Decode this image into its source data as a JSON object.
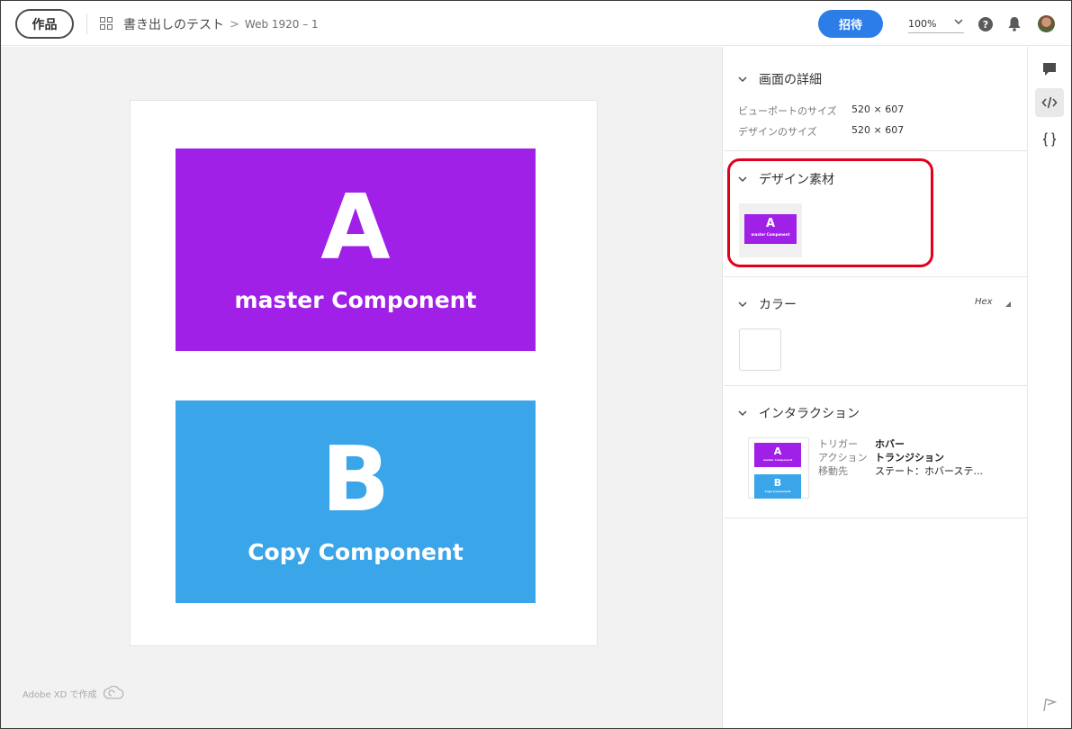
{
  "header": {
    "works_label": "作品",
    "project_name": "書き出しのテスト",
    "breadcrumb_sep": ">",
    "artboard_name": "Web 1920 – 1",
    "invite_label": "招待",
    "zoom_value": "100%"
  },
  "canvas": {
    "component_a": {
      "letter": "A",
      "label": "master Component",
      "color": "#a020e8"
    },
    "component_b": {
      "letter": "B",
      "label": "Copy Component",
      "color": "#3aa5e8"
    },
    "footer_note": "Adobe XD で作成"
  },
  "panel": {
    "details": {
      "title": "画面の詳細",
      "rows": [
        {
          "key": "ビューポートのサイズ",
          "value": "520 × 607"
        },
        {
          "key": "デザインのサイズ",
          "value": "520 × 607"
        }
      ]
    },
    "assets": {
      "title": "デザイン素材",
      "thumb_letter": "A",
      "thumb_label": "master Component",
      "highlight_color": "#e3001b"
    },
    "colors": {
      "title": "カラー",
      "format": "Hex"
    },
    "interactions": {
      "title": "インタラクション",
      "thumb_a_letter": "A",
      "thumb_a_label": "master Component",
      "thumb_b_letter": "B",
      "thumb_b_label": "Copy Component",
      "rows": [
        {
          "key": "トリガー",
          "value": "ホバー"
        },
        {
          "key": "アクション",
          "value": "トランジション"
        },
        {
          "key": "移動先",
          "value": "ステート：ホバーステ..."
        }
      ]
    }
  },
  "rail": {
    "items": [
      "comment-icon",
      "code-icon",
      "braces-icon"
    ],
    "active": "code-icon"
  }
}
